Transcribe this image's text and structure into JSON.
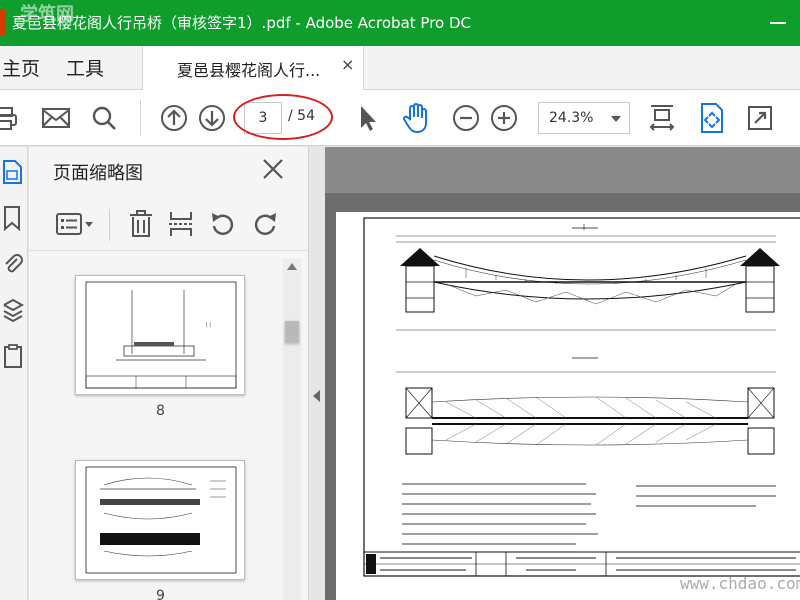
{
  "window": {
    "title": "夏邑县樱花阁人行吊桥（审核签字1）.pdf - Adobe Acrobat Pro DC"
  },
  "menu": {
    "home": "主页",
    "tools": "工具"
  },
  "tab": {
    "label": "夏邑县樱花阁人行...",
    "close": "×"
  },
  "toolbar": {
    "current_page": "3",
    "total_pages": "/ 54",
    "zoom": "24.3%"
  },
  "thumbnail_panel": {
    "title": "页面缩略图",
    "thumbnails": [
      {
        "page": "8"
      },
      {
        "page": "9"
      }
    ]
  },
  "watermark": {
    "top": "学筑网",
    "bottom": "www.chdao.com"
  },
  "colors": {
    "titlebar": "#0f9d2c",
    "accent_blue": "#1473e6",
    "highlight_oval": "#d42020"
  }
}
